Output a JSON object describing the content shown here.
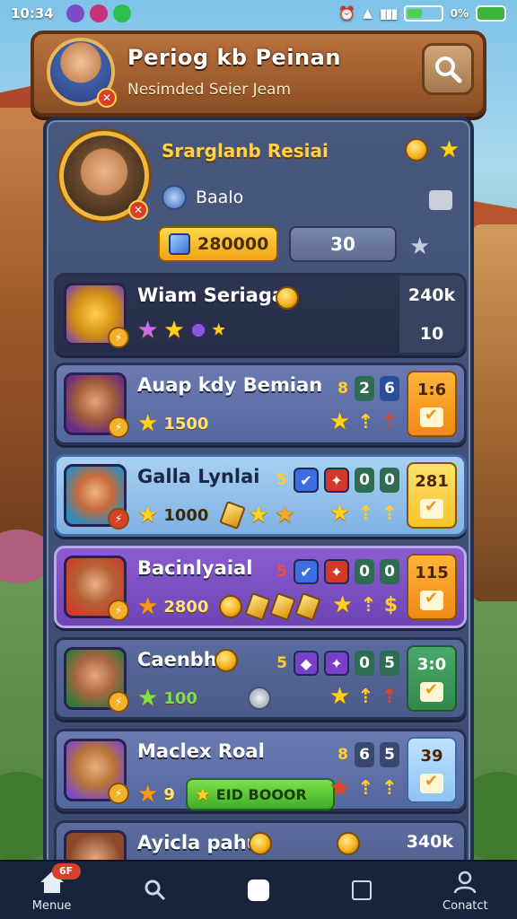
{
  "status_bar": {
    "time": "10:34",
    "battery_text": "0%"
  },
  "header": {
    "title": "Periog kb Peinan",
    "subtitle": "Nesimded Seier Jeam"
  },
  "profile": {
    "name": "Srarglanb Resiai",
    "sub_label": "Baalo",
    "gold": "280000",
    "level": "30"
  },
  "rows": [
    {
      "name": "Wiam Seriagar",
      "score": "",
      "rank_top": "240k",
      "rank_bottom": "10"
    },
    {
      "name": "Auap kdy Bemian",
      "score": "1500",
      "tag1": "2",
      "tag2": "6",
      "rank_top": "1:6",
      "prefix": "8"
    },
    {
      "name": "Galla Lynlai",
      "score": "1000",
      "tag1": "0",
      "tag2": "0",
      "rank_top": "281",
      "prefix": "5"
    },
    {
      "name": "Bacinlyaial",
      "score": "2800",
      "tag1": "0",
      "tag2": "0",
      "rank_top": "115",
      "prefix": "5"
    },
    {
      "name": "Caenbht",
      "score": "100",
      "tag1": "0",
      "tag2": "5",
      "rank_top": "3:0",
      "prefix": "5"
    },
    {
      "name": "Maclex Roal",
      "score": "9",
      "tag1": "6",
      "tag2": "5",
      "rank_top": "39",
      "prefix": "8",
      "button": "EID BOOOR"
    },
    {
      "name": "Ayicla pahur",
      "rank_top": "340k"
    }
  ],
  "nav": {
    "home": "Menue",
    "contact": "Conatct",
    "badge": "6F"
  },
  "colors": {
    "panel": "#3b4a6f",
    "gold": "#ffd24a",
    "orange": "#f08a14",
    "header": "#8a4e24"
  }
}
